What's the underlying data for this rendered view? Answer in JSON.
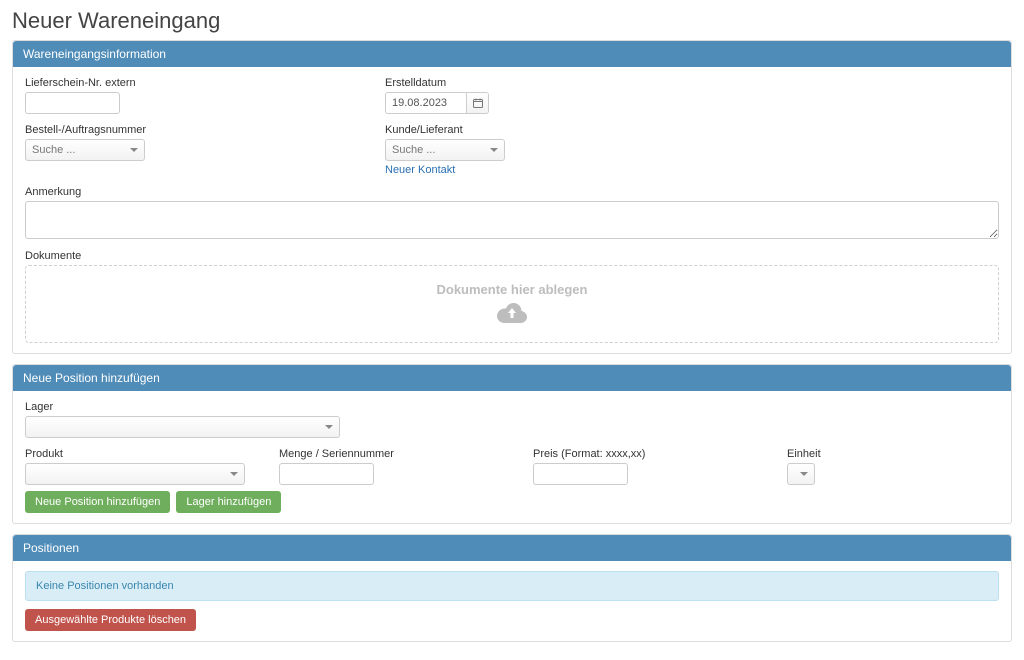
{
  "page": {
    "title": "Neuer Wareneingang"
  },
  "panel_info": {
    "header": "Wareneingangsinformation",
    "lieferschein_label": "Lieferschein-Nr. extern",
    "lieferschein_value": "",
    "erstelldatum_label": "Erstelldatum",
    "erstelldatum_value": "19.08.2023",
    "bestell_label": "Bestell-/Auftragsnummer",
    "bestell_placeholder": "Suche ...",
    "kunde_label": "Kunde/Lieferant",
    "kunde_placeholder": "Suche ...",
    "neuer_kontakt": "Neuer Kontakt",
    "anmerkung_label": "Anmerkung",
    "anmerkung_value": "",
    "dokumente_label": "Dokumente",
    "dropzone_text": "Dokumente hier ablegen"
  },
  "panel_newpos": {
    "header": "Neue Position hinzufügen",
    "lager_label": "Lager",
    "produkt_label": "Produkt",
    "menge_label": "Menge / Seriennummer",
    "preis_label": "Preis (Format: xxxx,xx)",
    "einheit_label": "Einheit",
    "btn_add_position": "Neue Position hinzufügen",
    "btn_add_lager": "Lager hinzufügen"
  },
  "panel_positionen": {
    "header": "Positionen",
    "empty_text": "Keine Positionen vorhanden",
    "btn_delete_selected": "Ausgewählte Produkte löschen"
  }
}
